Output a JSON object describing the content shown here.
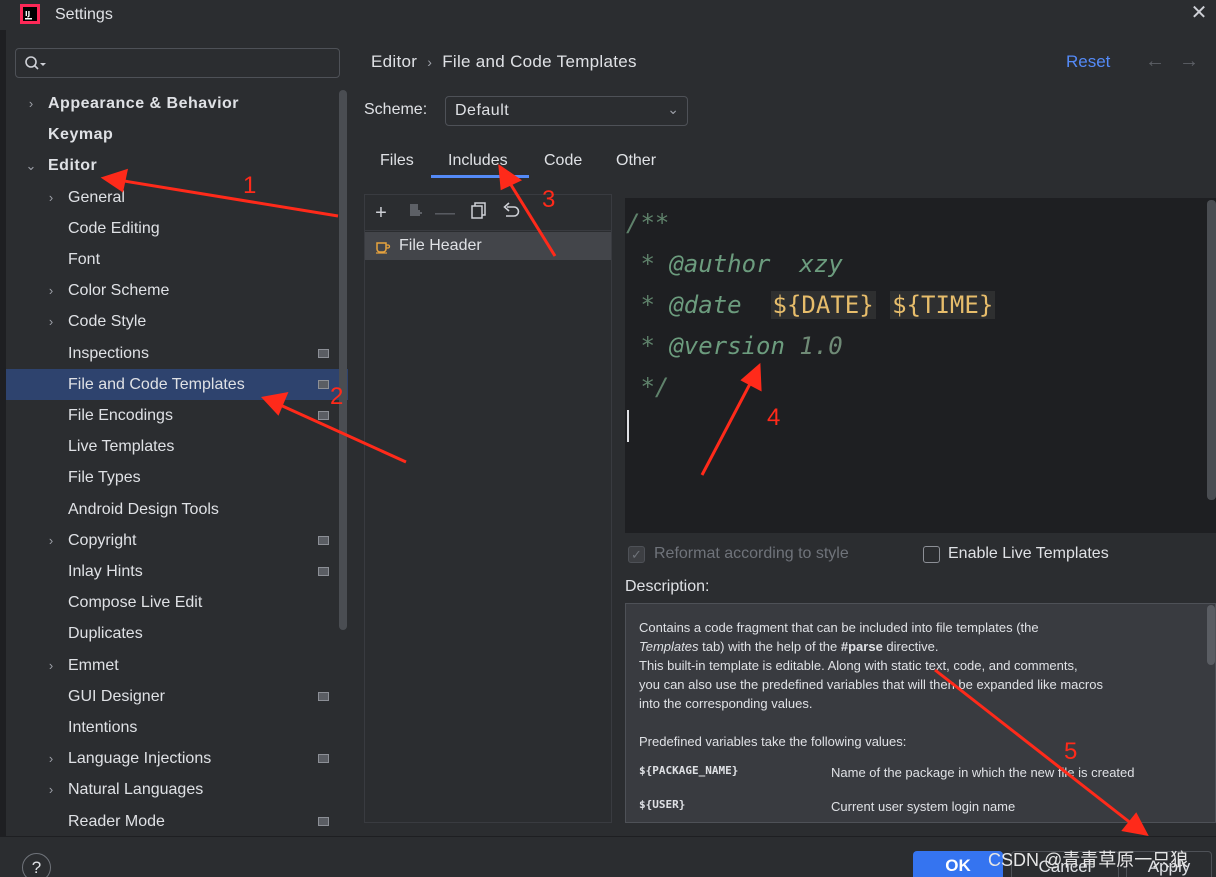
{
  "window": {
    "title": "Settings"
  },
  "search": {
    "placeholder": ""
  },
  "sidebar": {
    "items": [
      {
        "label": "Appearance & Behavior",
        "expandable": true,
        "expanded": false
      },
      {
        "label": "Keymap",
        "expandable": false
      },
      {
        "label": "Editor",
        "expandable": true,
        "expanded": true
      },
      {
        "label": "General",
        "expandable": true
      },
      {
        "label": "Code Editing",
        "expandable": false
      },
      {
        "label": "Font",
        "expandable": false
      },
      {
        "label": "Color Scheme",
        "expandable": true
      },
      {
        "label": "Code Style",
        "expandable": true
      },
      {
        "label": "Inspections",
        "expandable": false,
        "badge": true
      },
      {
        "label": "File and Code Templates",
        "expandable": false,
        "badge": true,
        "selected": true
      },
      {
        "label": "File Encodings",
        "expandable": false,
        "badge": true
      },
      {
        "label": "Live Templates",
        "expandable": false
      },
      {
        "label": "File Types",
        "expandable": false
      },
      {
        "label": "Android Design Tools",
        "expandable": false
      },
      {
        "label": "Copyright",
        "expandable": true,
        "badge": true
      },
      {
        "label": "Inlay Hints",
        "expandable": false,
        "badge": true
      },
      {
        "label": "Compose Live Edit",
        "expandable": false
      },
      {
        "label": "Duplicates",
        "expandable": false
      },
      {
        "label": "Emmet",
        "expandable": true
      },
      {
        "label": "GUI Designer",
        "expandable": false,
        "badge": true
      },
      {
        "label": "Intentions",
        "expandable": false
      },
      {
        "label": "Language Injections",
        "expandable": true,
        "badge": true
      },
      {
        "label": "Natural Languages",
        "expandable": true
      },
      {
        "label": "Reader Mode",
        "expandable": false,
        "badge": true
      }
    ]
  },
  "breadcrumb": {
    "parent": "Editor",
    "current": "File and Code Templates"
  },
  "header": {
    "reset_label": "Reset",
    "back_icon": "arrow-left-icon",
    "forward_icon": "arrow-right-icon"
  },
  "scheme": {
    "label": "Scheme:",
    "value": "Default"
  },
  "tabs": [
    {
      "label": "Files"
    },
    {
      "label": "Includes",
      "active": true
    },
    {
      "label": "Code"
    },
    {
      "label": "Other"
    }
  ],
  "templates": {
    "toolbar": [
      "add-icon",
      "copy-template-icon",
      "remove-icon",
      "duplicate-icon",
      "revert-icon"
    ],
    "items": [
      {
        "label": "File Header",
        "selected": true
      }
    ]
  },
  "editor": {
    "lines": {
      "l1": "/**",
      "l2_star": " * ",
      "l2_tag": "@author",
      "l2_val": "  xzy",
      "l3_star": " * ",
      "l3_tag": "@date",
      "l3_var1": "${DATE}",
      "l3_var2": "${TIME}",
      "l4_star": " * ",
      "l4_tag": "@version",
      "l4_val": " 1.0",
      "l5": " */"
    }
  },
  "options": {
    "reformat": {
      "label": "Reformat according to style",
      "checked": true,
      "enabled": false
    },
    "live_templates": {
      "label": "Enable Live Templates",
      "checked": false
    }
  },
  "description": {
    "label": "Description:",
    "p1a": "Contains a code fragment that can be included into file templates (the",
    "p1b_em": "Templates",
    "p1b_rest": " tab) with the help of the ",
    "p1b_bold": "#parse",
    "p1b_end": " directive.",
    "p2": "This built-in template is editable. Along with static text, code, and comments,",
    "p3": "you can also use the predefined variables that will then be expanded like macros",
    "p4": "into the corresponding values.",
    "p5": "Predefined variables take the following values:",
    "vars": [
      {
        "name": "${PACKAGE_NAME}",
        "desc": "Name of the package in which the new file is created"
      },
      {
        "name": "${USER}",
        "desc": "Current user system login name"
      }
    ]
  },
  "footer": {
    "help": "?",
    "ok": "OK",
    "cancel": "Cancel",
    "apply": "Apply"
  },
  "annotations": {
    "n1": "1",
    "n2": "2",
    "n3": "3",
    "n4": "4",
    "n5": "5",
    "color": "#ff2a1a"
  },
  "watermark": "CSDN @青青草原一只狼",
  "colors": {
    "accent": "#3574f0",
    "link": "#548af7",
    "selection": "#2e436e",
    "background": "#2b2d30"
  }
}
